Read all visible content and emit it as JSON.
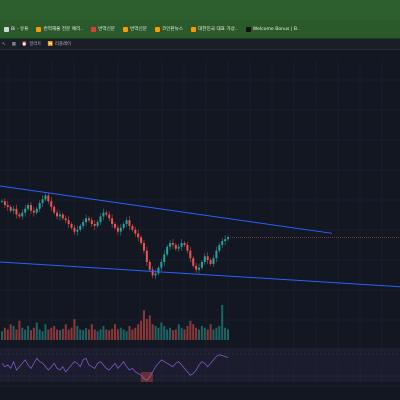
{
  "window": {
    "tab_strip_visible": true
  },
  "bookmarks": {
    "items": [
      {
        "label": "Bi - 유튜",
        "icon": "page-icon",
        "color": "#cfd8dc"
      },
      {
        "label": "번역해줄 전문 예리..",
        "icon": "bookmark-icon",
        "color": "#ff9800"
      },
      {
        "label": "번역신문",
        "icon": "shield-icon",
        "color": "#e53935"
      },
      {
        "label": "번역신문",
        "icon": "bookmark-icon",
        "color": "#ff9800"
      },
      {
        "label": "코인판뉴스",
        "icon": "bookmark-icon",
        "color": "#ff9800"
      },
      {
        "label": "대한민국 대표 가상..",
        "icon": "bookmark-icon",
        "color": "#ff9800"
      },
      {
        "label": "Welcome Bonus | B..",
        "icon": "circle-icon",
        "color": "#111111"
      }
    ]
  },
  "toolbar": {
    "items": [
      {
        "label": "",
        "icon": "cursor-icon"
      },
      {
        "label": "",
        "icon": "layout-icon"
      },
      {
        "label": "알러트",
        "icon": "alert-icon"
      },
      {
        "label": "리플레이",
        "icon": "replay-icon"
      }
    ]
  },
  "symbol_info": {
    "text": ""
  },
  "chart_data": {
    "type": "line",
    "title": "",
    "xlabel": "",
    "ylabel": "",
    "price_path": [
      0.52,
      0.5,
      0.49,
      0.47,
      0.48,
      0.45,
      0.44,
      0.46,
      0.48,
      0.5,
      0.47,
      0.46,
      0.48,
      0.51,
      0.53,
      0.55,
      0.52,
      0.49,
      0.46,
      0.44,
      0.45,
      0.43,
      0.42,
      0.4,
      0.38,
      0.36,
      0.37,
      0.39,
      0.41,
      0.43,
      0.42,
      0.4,
      0.39,
      0.41,
      0.44,
      0.46,
      0.45,
      0.43,
      0.4,
      0.38,
      0.36,
      0.38,
      0.4,
      0.42,
      0.39,
      0.37,
      0.35,
      0.33,
      0.3,
      0.26,
      0.2,
      0.16,
      0.13,
      0.14,
      0.17,
      0.2,
      0.24,
      0.28,
      0.3,
      0.29,
      0.27,
      0.28,
      0.3,
      0.29,
      0.26,
      0.22,
      0.18,
      0.16,
      0.17,
      0.2,
      0.23,
      0.21,
      0.19,
      0.22,
      0.26,
      0.29,
      0.31,
      0.32,
      0.33
    ],
    "upper_trendline": [
      [
        0.0,
        0.6
      ],
      [
        1.0,
        0.3
      ]
    ],
    "lower_trendline": [
      [
        0.0,
        0.2
      ],
      [
        1.0,
        0.07
      ]
    ],
    "volume": [
      0.25,
      0.35,
      0.3,
      0.45,
      0.4,
      0.3,
      0.55,
      0.35,
      0.3,
      0.4,
      0.28,
      0.35,
      0.5,
      0.3,
      0.25,
      0.45,
      0.3,
      0.35,
      0.4,
      0.3,
      0.28,
      0.32,
      0.45,
      0.3,
      0.35,
      0.6,
      0.4,
      0.3,
      0.28,
      0.34,
      0.3,
      0.45,
      0.3,
      0.25,
      0.3,
      0.4,
      0.3,
      0.28,
      0.32,
      0.45,
      0.3,
      0.35,
      0.3,
      0.25,
      0.4,
      0.3,
      0.35,
      0.45,
      0.55,
      0.85,
      0.6,
      0.7,
      0.45,
      0.4,
      0.35,
      0.5,
      0.4,
      0.3,
      0.35,
      0.28,
      0.3,
      0.45,
      0.35,
      0.3,
      0.4,
      0.55,
      0.45,
      0.35,
      0.3,
      0.4,
      0.35,
      0.3,
      0.45,
      0.3,
      0.35,
      0.4,
      1.0,
      0.35,
      0.3
    ],
    "oscillator": [
      0.55,
      0.45,
      0.5,
      0.4,
      0.6,
      0.35,
      0.45,
      0.55,
      0.65,
      0.5,
      0.4,
      0.55,
      0.7,
      0.6,
      0.55,
      0.45,
      0.35,
      0.45,
      0.55,
      0.4,
      0.35,
      0.45,
      0.3,
      0.4,
      0.5,
      0.6,
      0.55,
      0.45,
      0.65,
      0.7,
      0.5,
      0.45,
      0.4,
      0.55,
      0.6,
      0.5,
      0.4,
      0.35,
      0.45,
      0.55,
      0.4,
      0.5,
      0.6,
      0.45,
      0.35,
      0.4,
      0.3,
      0.25,
      0.2,
      0.1,
      0.05,
      0.15,
      0.3,
      0.45,
      0.55,
      0.65,
      0.6,
      0.55,
      0.5,
      0.45,
      0.55,
      0.6,
      0.5,
      0.4,
      0.3,
      0.2,
      0.25,
      0.35,
      0.5,
      0.6,
      0.55,
      0.45,
      0.55,
      0.65,
      0.75,
      0.8,
      0.78,
      0.75,
      0.72
    ],
    "x_ticks": [
      "",
      "",
      "",
      "",
      "",
      "",
      "",
      "",
      "",
      "",
      "",
      "",
      "",
      "",
      "",
      "",
      "",
      "",
      ""
    ],
    "grid": true
  },
  "colors": {
    "background": "#131722",
    "up": "#26a69a",
    "down": "#ef5350",
    "trendline": "#2962ff",
    "oscillator": "#7e57c2",
    "price_marker": "#ef5350"
  }
}
